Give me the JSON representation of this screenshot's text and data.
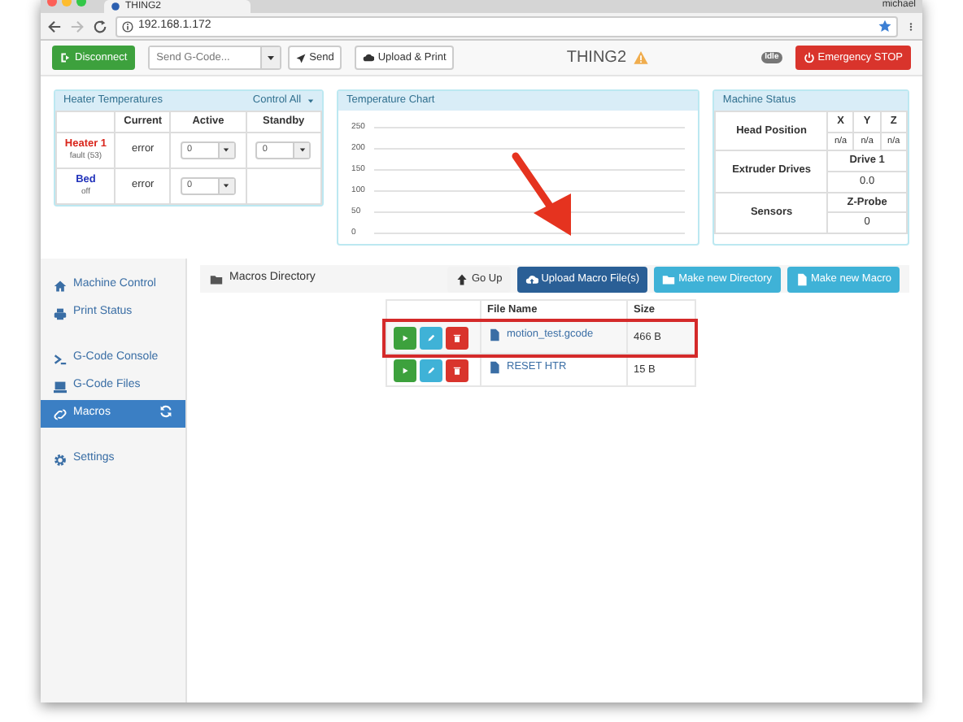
{
  "browser": {
    "tab_title": "THING2",
    "user": "michael",
    "url": "192.168.1.172"
  },
  "toolbar": {
    "disconnect": "Disconnect",
    "gcode_placeholder": "Send G-Code...",
    "send": "Send",
    "upload_print": "Upload & Print",
    "machine_name": "THING2",
    "status": "Idle",
    "emergency": "Emergency STOP"
  },
  "heaters": {
    "title": "Heater Temperatures",
    "control_all": "Control All",
    "columns": [
      "Current",
      "Active",
      "Standby"
    ],
    "rows": [
      {
        "name": "Heater 1",
        "color": "#d9261c",
        "state": "fault (53)",
        "current": "error",
        "active": "0",
        "standby": "0"
      },
      {
        "name": "Bed",
        "color": "#2233bb",
        "state": "off",
        "current": "error",
        "active": "0"
      }
    ]
  },
  "temperature_chart": {
    "title": "Temperature Chart",
    "y_labels": [
      "250",
      "200",
      "150",
      "100",
      "50",
      "0"
    ]
  },
  "machine_status": {
    "title": "Machine Status",
    "head_position": {
      "label": "Head Position",
      "axes": [
        "X",
        "Y",
        "Z"
      ],
      "values": [
        "n/a",
        "n/a",
        "n/a"
      ]
    },
    "extruder": {
      "label": "Extruder Drives",
      "drive": "Drive 1",
      "value": "0.0"
    },
    "sensors": {
      "label": "Sensors",
      "probe": "Z-Probe",
      "value": "0"
    }
  },
  "sidebar": {
    "items": [
      {
        "label": "Machine Control",
        "selected": false
      },
      {
        "label": "Print Status",
        "selected": false
      },
      {
        "label": "G-Code Console",
        "selected": false
      },
      {
        "label": "G-Code Files",
        "selected": false
      },
      {
        "label": "Macros",
        "selected": true
      },
      {
        "label": "Settings",
        "selected": false
      }
    ]
  },
  "macros": {
    "directory": "Macros Directory",
    "buttons": [
      {
        "label": "Go Up",
        "kind": "light"
      },
      {
        "label": "Upload Macro File(s)",
        "kind": "primary"
      },
      {
        "label": "Make new Directory",
        "kind": "info"
      },
      {
        "label": "Make new Macro",
        "kind": "info"
      }
    ],
    "columns": [
      "File Name",
      "Size"
    ],
    "files": [
      {
        "name": "motion_test.gcode",
        "size": "466 B",
        "highlighted": true
      },
      {
        "name": "RESET HTR",
        "size": "15 B",
        "highlighted": false
      }
    ]
  }
}
